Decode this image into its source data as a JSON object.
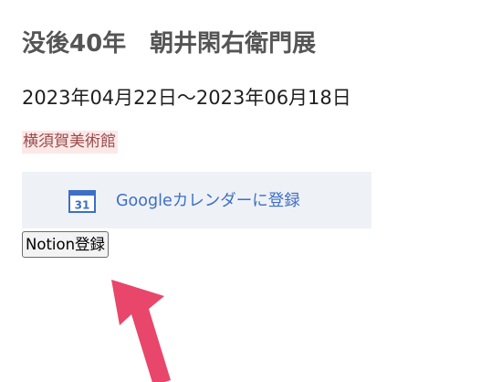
{
  "event": {
    "title": "没後40年　朝井閑右衛門展",
    "period": "2023年04月22日〜2023年06月18日",
    "venue": "横須賀美術館"
  },
  "buttons": {
    "google_calendar_label": "Googleカレンダーに登録",
    "google_calendar_icon_number": "31",
    "notion_label": "Notion登録"
  },
  "colors": {
    "title": "#555555",
    "venue_text": "#9b4b4b",
    "venue_background": "#fbe9e8",
    "gcal_background": "#eef1f6",
    "gcal_accent": "#3d6fc4",
    "annotation_arrow": "#e8466a"
  },
  "annotation": {
    "icon": "pink-arrow-icon",
    "points_to": "notion-register-button"
  }
}
